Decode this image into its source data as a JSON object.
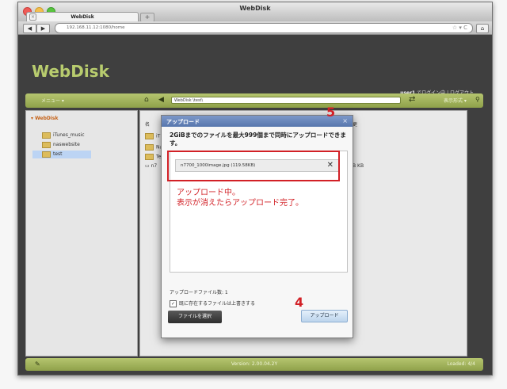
{
  "browser": {
    "window_title": "WebDisk",
    "tab_label": "WebDisk",
    "tab_close": "×",
    "new_tab": "+",
    "back": "◀",
    "forward": "▶",
    "address": "192.168.11.12:1080/home",
    "address_icons": "☆ ▾ C",
    "home_button": "⌂"
  },
  "app": {
    "logo": "WebDisk",
    "user_name": "user1",
    "user_status": "でログイン中 | ログアウト",
    "menu_label": "メニュー ▾",
    "path_value": "WebDisk \\test\\",
    "display_label": "表示形式 ▾",
    "version": "Version: 2.00.04.2Y",
    "loaded": "Loaded: 4/4"
  },
  "sidebar": {
    "root": "▾ WebDisk",
    "items": [
      {
        "label": "iTunes_music"
      },
      {
        "label": "naswebsite"
      },
      {
        "label": "test"
      }
    ]
  },
  "content": {
    "rows": [
      {
        "label": "名"
      },
      {
        "label": "iT"
      },
      {
        "label": "Na"
      },
      {
        "label": "Te"
      },
      {
        "label": "n7"
      }
    ],
    "right_header": "更",
    "right_size": "B KB"
  },
  "dialog": {
    "title": "アップロード",
    "close": "×",
    "message": "2GiBまでのファイルを最大999個まで同時にアップロードできます。",
    "file_name": "n7700_1000image.jpg (119.58KB)",
    "file_remove": "✕",
    "count_label": "アップロードファイル数: 1",
    "overwrite_check": "✓",
    "overwrite_label": "既に存在するファイルは上書きする",
    "select_button": "ファイルを選択",
    "upload_button": "アップロード"
  },
  "annotations": {
    "step5": "5",
    "step4": "4",
    "note_line1": "アップロード中。",
    "note_line2": "表示が消えたらアップロード完了。",
    "color": "#d22026"
  }
}
